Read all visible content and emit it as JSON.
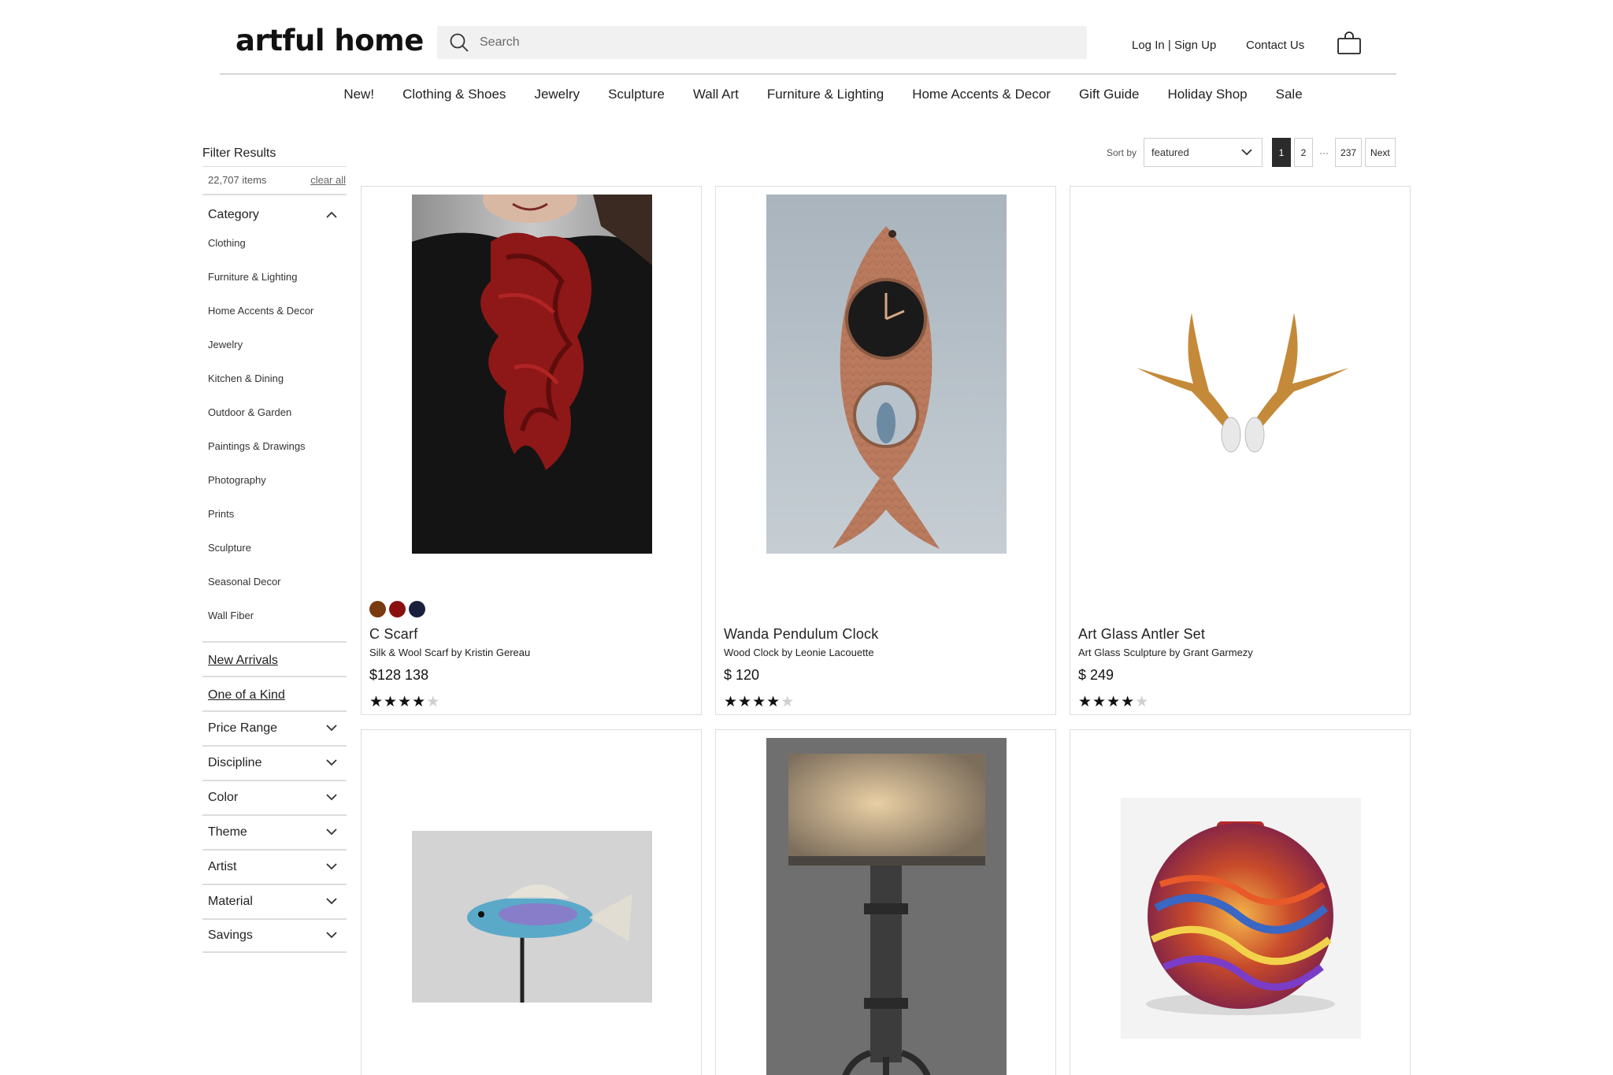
{
  "header": {
    "logo": "artful home",
    "search_placeholder": "Search",
    "login": "Log In",
    "separator": "|",
    "signup": "Sign Up",
    "contact": "Contact Us"
  },
  "nav": [
    "New!",
    "Clothing & Shoes",
    "Jewelry",
    "Sculpture",
    "Wall Art",
    "Furniture & Lighting",
    "Home Accents & Decor",
    "Gift Guide",
    "Holiday Shop",
    "Sale"
  ],
  "sidebar": {
    "title": "Filter Results",
    "item_count": "22,707 items",
    "clear_all": "clear all",
    "category_heading": "Category",
    "categories": [
      "Clothing",
      "Furniture & Lighting",
      "Home Accents & Decor",
      "Jewelry",
      "Kitchen & Dining",
      "Outdoor & Garden",
      "Paintings & Drawings",
      "Photography",
      "Prints",
      "Sculpture",
      "Seasonal Decor",
      "Wall Fiber"
    ],
    "links": [
      "New Arrivals",
      "One of a Kind"
    ],
    "facets": [
      "Price Range",
      "Discipline",
      "Color",
      "Theme",
      "Artist",
      "Material",
      "Savings"
    ]
  },
  "toolbar": {
    "sort_label": "Sort by",
    "sort_value": "featured",
    "pages": [
      "1",
      "2"
    ],
    "dots": "···",
    "last_page": "237",
    "next": "Next"
  },
  "products": [
    {
      "name": "C Scarf",
      "subtitle": "Silk & Wool Scarf by Kristin Gereau",
      "price": "$128 138",
      "rating": 4,
      "swatches": [
        "#7a3a10",
        "#8a1010",
        "#1a1f3d"
      ]
    },
    {
      "name": "Wanda Pendulum Clock",
      "subtitle": "Wood Clock by Leonie Lacouette",
      "price": "$ 120",
      "rating": 4
    },
    {
      "name": "Art Glass Antler Set",
      "subtitle": "Art Glass Sculpture by Grant Garmezy",
      "price": "$ 249",
      "rating": 4
    }
  ],
  "icons": {
    "search": "search-icon",
    "bag": "shopping-bag-icon",
    "chevron_up": "chevron-up-icon",
    "chevron_down": "chevron-down-icon",
    "star": "star-icon"
  }
}
